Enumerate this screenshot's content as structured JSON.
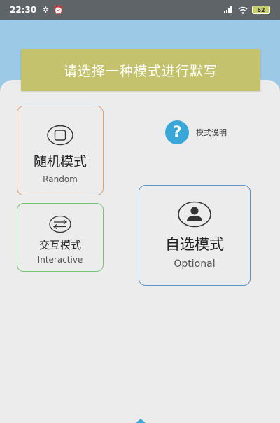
{
  "status_bar": {
    "time": "22:30",
    "battery": "62"
  },
  "banner": {
    "text": "请选择一种模式进行默写"
  },
  "help": {
    "icon_text": "?",
    "label": "模式说明"
  },
  "modes": {
    "random": {
      "title": "随机模式",
      "subtitle": "Random",
      "icon": "square-in-circle-icon",
      "border_color": "#e0a070"
    },
    "interactive": {
      "title": "交互模式",
      "subtitle": "Interactive",
      "icon": "swap-arrows-icon",
      "border_color": "#7cc07c"
    },
    "optional": {
      "title": "自选模式",
      "subtitle": "Optional",
      "icon": "user-avatar-icon",
      "border_color": "#5d93c6"
    }
  },
  "colors": {
    "header": "#9cc9e6",
    "banner": "#c4c26c",
    "accent": "#3aa7d9",
    "status_bar": "#5f6468"
  }
}
